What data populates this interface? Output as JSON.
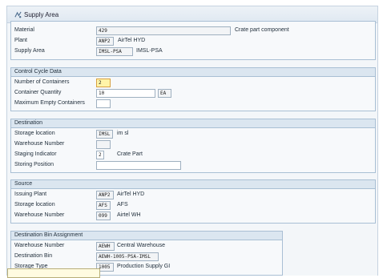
{
  "window": {
    "title": "Supply Area"
  },
  "general": {
    "material_label": "Material",
    "material_value": "429",
    "material_desc": "Crate part component",
    "plant_label": "Plant",
    "plant_value": "ANP2",
    "plant_desc": "AirTel HYD",
    "supply_area_label": "Supply Area",
    "supply_area_value": "IMSL-PSA",
    "supply_area_desc": "IMSL-PSA"
  },
  "control_cycle": {
    "title": "Control Cycle Data",
    "num_containers_label": "Number of Containers",
    "num_containers_value": "2",
    "container_qty_label": "Container Quantity",
    "container_qty_value": "10",
    "container_qty_unit": "EA",
    "max_empty_label": "Maximum Empty Containers",
    "max_empty_value": ""
  },
  "destination": {
    "title": "Destination",
    "storage_location_label": "Storage location",
    "storage_location_value": "IMSL",
    "storage_location_desc": "im sl",
    "warehouse_number_label": "Warehouse Number",
    "warehouse_number_value": "",
    "staging_indicator_label": "Staging Indicator",
    "staging_indicator_value": "2",
    "staging_indicator_desc": "Crate Part",
    "storing_position_label": "Storing Position",
    "storing_position_value": ""
  },
  "source": {
    "title": "Source",
    "issuing_plant_label": "Issuing Plant",
    "issuing_plant_value": "ANP2",
    "issuing_plant_desc": "AirTel HYD",
    "storage_location_label": "Storage location",
    "storage_location_value": "AFS",
    "storage_location_desc": "AFS",
    "warehouse_number_label": "Warehouse Number",
    "warehouse_number_value": "099",
    "warehouse_number_desc": "Airtel WH"
  },
  "dest_bin": {
    "title": "Destination Bin Assignment",
    "warehouse_number_label": "Warehouse Number",
    "warehouse_number_value": "AEWH",
    "warehouse_number_desc": "Central Warehouse",
    "destination_bin_label": "Destination Bin",
    "destination_bin_value": "AEWH-1005-PSA-IMSL",
    "storage_type_label": "Storage Type",
    "storage_type_value": "1005",
    "storage_type_desc": "Production Supply GI"
  }
}
